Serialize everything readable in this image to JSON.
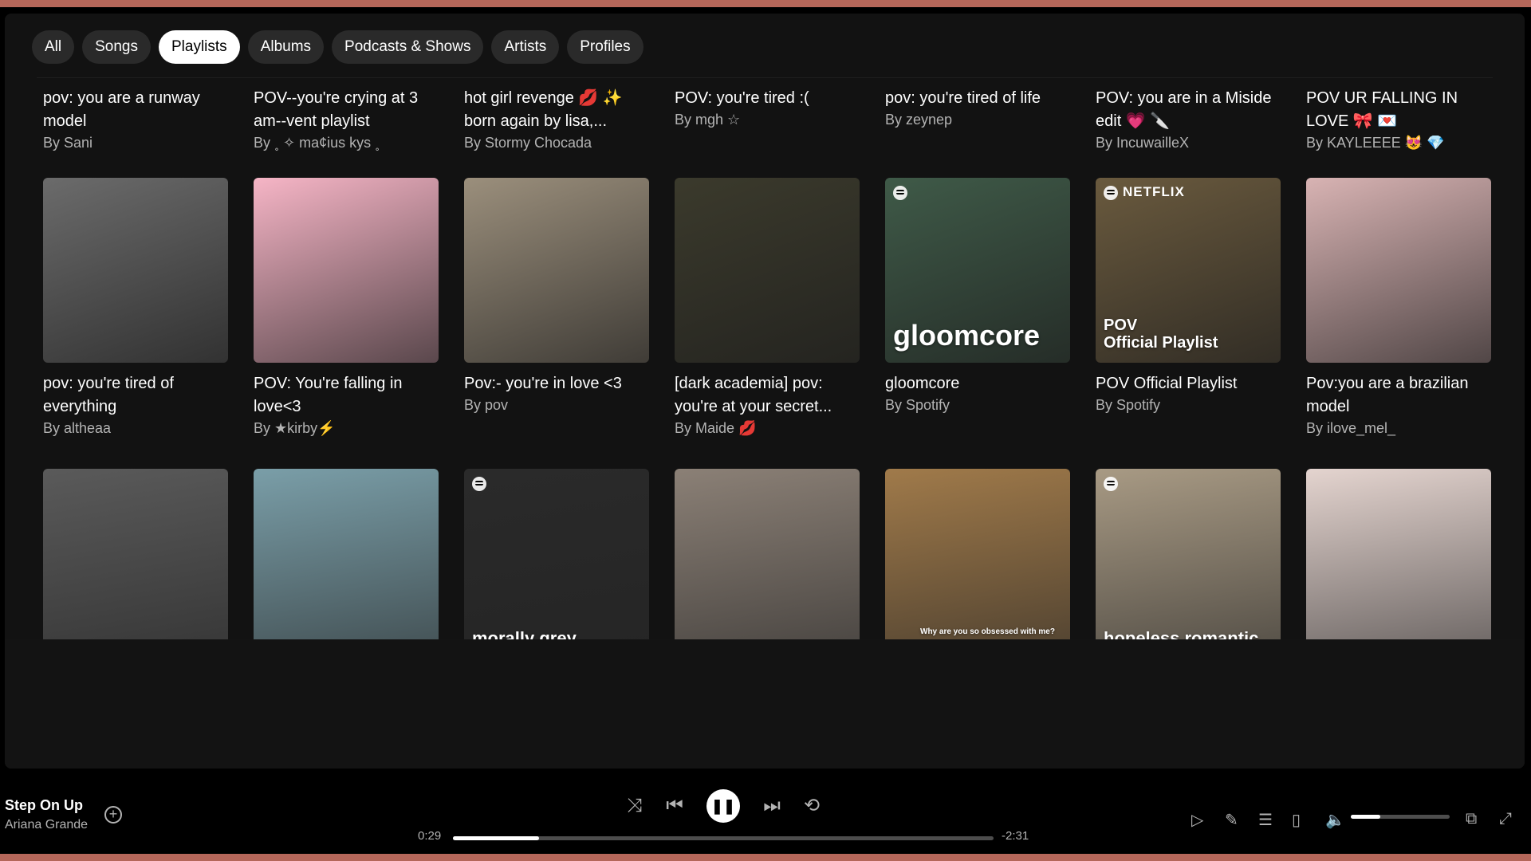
{
  "filters": [
    "All",
    "Songs",
    "Playlists",
    "Albums",
    "Podcasts & Shows",
    "Artists",
    "Profiles"
  ],
  "active_filter": "Playlists",
  "rows": [
    [
      {
        "title": "pov: you are a runway model",
        "by": "By Sani"
      },
      {
        "title": "POV--you're crying at 3 am--vent playlist",
        "by": "By ˳ ✧ ma¢ius kys ˳"
      },
      {
        "title": "hot girl revenge 💋 ✨ born again by lisa,...",
        "by": "By Stormy Chocada"
      },
      {
        "title": "POV: you're tired :(",
        "by": "By mgh ☆"
      },
      {
        "title": "pov: you're tired of life",
        "by": "By zeynep"
      },
      {
        "title": "POV: you are in a Miside edit 💗 🔪",
        "by": "By IncuwailleX"
      },
      {
        "title": "POV UR FALLING IN LOVE 🎀 💌",
        "by": "By KAYLEEEE 😻 💎"
      }
    ],
    [
      {
        "title": "pov: you're tired of everything",
        "by": "By altheaa",
        "cover": "#6b6b6b",
        "label": ""
      },
      {
        "title": "POV: You're falling in love<3",
        "by": "By ★kirby⚡",
        "cover": "#f6b5c6",
        "label": ""
      },
      {
        "title": "Pov:- you're in love <3",
        "by": "By pov",
        "cover": "#9b8f7c",
        "label": ""
      },
      {
        "title": "[dark academia] pov: you're at your secret...",
        "by": "By Maide 💋",
        "cover": "#3b3a2c",
        "label": ""
      },
      {
        "title": "gloomcore",
        "by": "By Spotify",
        "cover": "#3f5a48",
        "label": "gloomcore"
      },
      {
        "title": "POV Official Playlist",
        "by": "By Spotify",
        "cover": "#6a5a3e",
        "label": "POV\nOfficial Playlist"
      },
      {
        "title": "Pov:you are a brazilian model",
        "by": "By ilove_mel_",
        "cover": "#d8b3b3",
        "label": ""
      }
    ],
    [
      {
        "cover": "#5a5a5a",
        "label": ""
      },
      {
        "cover": "#7a9ea8",
        "label": ""
      },
      {
        "cover": "#2a2a2a",
        "label": "morally grey"
      },
      {
        "cover": "#8b8076",
        "label": ""
      },
      {
        "cover": "#a07a4a",
        "label": "Why are you so obsessed with me?"
      },
      {
        "cover": "#a89a84",
        "label": "hopeless romantic"
      },
      {
        "cover": "#e4d4cf",
        "label": ""
      }
    ]
  ],
  "cover_brand": {
    "netflix": "NETFLIX"
  },
  "player": {
    "track": "Step On Up",
    "artist": "Ariana Grande",
    "elapsed": "0:29",
    "remaining": "-2:31",
    "progress": 0.16,
    "volume": 0.3
  }
}
